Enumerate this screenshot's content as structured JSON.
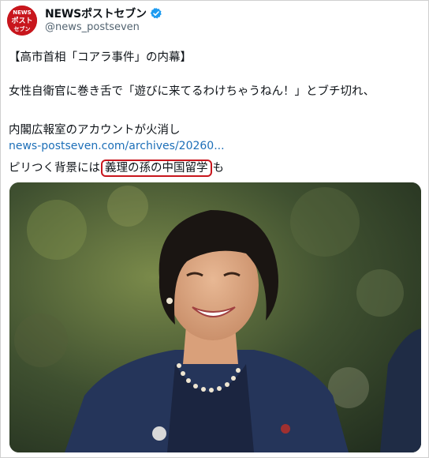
{
  "account": {
    "display_name": "NEWSポストセブン",
    "handle": "@news_postseven",
    "avatar_text_top": "NEWS",
    "avatar_text_mid": "ポスト",
    "avatar_text_bot": "セブン",
    "verified_icon": "verified-badge-icon"
  },
  "post": {
    "line1": "【高市首相「コアラ事件」の内幕】",
    "line2": "女性自衛官に巻き舌で「遊びに来てるわけちゃうねん！」とブチ切れ、",
    "line3": "内閣広報室のアカウントが火消し",
    "link": "news-postseven.com/archives/20260...",
    "line5_prefix": "ピリつく背景には",
    "line5_highlight": "義理の孫の中国留学",
    "line5_suffix": "も"
  },
  "colors": {
    "brand_red": "#c8161d",
    "link_blue": "#1d6fb8",
    "verified_blue": "#1d9bf0"
  }
}
